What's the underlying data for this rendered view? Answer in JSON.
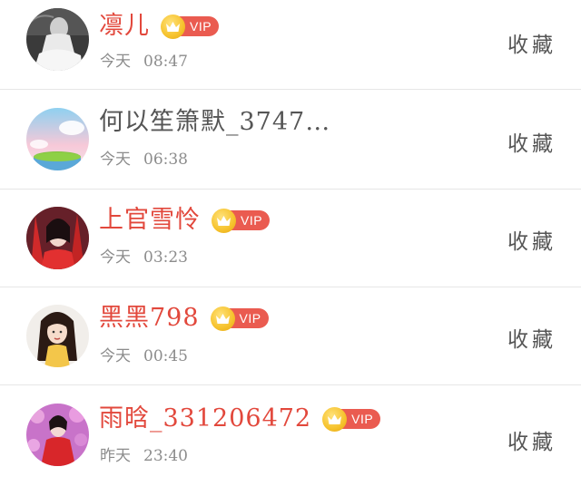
{
  "vip_label": "VIP",
  "colors": {
    "vip_name": "#e2483c",
    "plain_name": "#555555",
    "vip_badge": "#ea5b50",
    "vip_crown": "#f6c22c",
    "time": "#8c8c8c",
    "divider": "#e6e6e6"
  },
  "users": [
    {
      "name": "凛儿",
      "is_vip": true,
      "day": "今天",
      "time": "08:47",
      "action_label": "收藏",
      "avatar_icon": "bride-white-dress-avatar"
    },
    {
      "name": "何以笙箫默_3747…",
      "is_vip": false,
      "day": "今天",
      "time": "06:38",
      "action_label": "收藏",
      "avatar_icon": "sky-island-avatar"
    },
    {
      "name": "上官雪怜",
      "is_vip": true,
      "day": "今天",
      "time": "03:23",
      "action_label": "收藏",
      "avatar_icon": "red-costume-girl-avatar"
    },
    {
      "name": "黑黑798",
      "is_vip": true,
      "day": "今天",
      "time": "00:45",
      "action_label": "收藏",
      "avatar_icon": "cartoon-princess-avatar"
    },
    {
      "name": "雨晗_331206472",
      "is_vip": true,
      "day": "昨天",
      "time": "23:40",
      "action_label": "收藏",
      "avatar_icon": "pink-blossom-girl-avatar"
    }
  ]
}
